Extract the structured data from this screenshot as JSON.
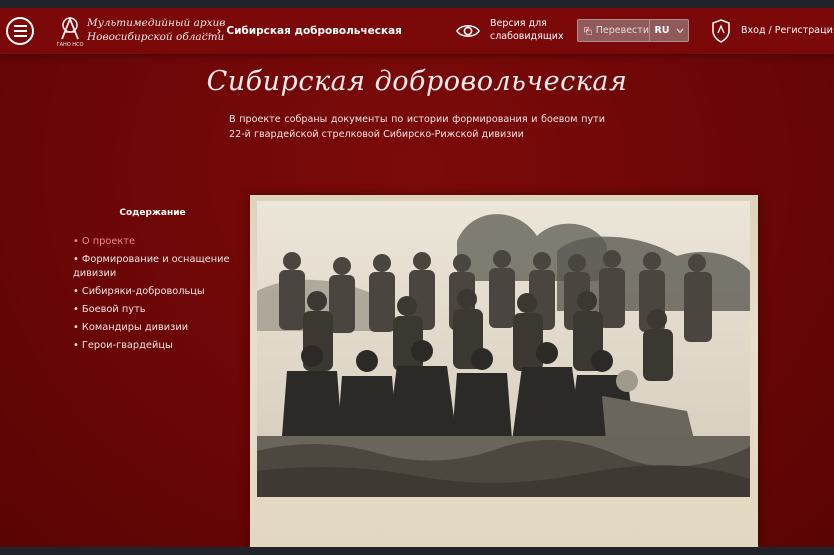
{
  "header": {
    "logo_line1": "Мультимедийный архив",
    "logo_line2": "Новосибирской области",
    "logo_caption": "ГАНО НСО",
    "breadcrumb_dots": "...",
    "breadcrumb_current": "Сибирская добровольческая",
    "low_vision_line1": "Версия для",
    "low_vision_line2": "слабовидящих",
    "translate_label": "Перевести",
    "language": "RU",
    "login_label": "Вход / Регистрация"
  },
  "main": {
    "title": "Сибирская добровольческая",
    "description": "В проекте собраны документы по истории формирования и боевом пути 22-й гвардейской стрелковой Сибирско-Рижской дивизии"
  },
  "toc": {
    "heading": "Содержание",
    "items": [
      {
        "label": "• О проекте",
        "active": true
      },
      {
        "label": "• Формирование и оснащение дивизии",
        "active": false
      },
      {
        "label": "• Сибиряки-добровольцы",
        "active": false
      },
      {
        "label": "• Боевой путь",
        "active": false
      },
      {
        "label": "• Командиры дивизии",
        "active": false
      },
      {
        "label": "• Герои-гвардейцы",
        "active": false
      }
    ]
  },
  "colors": {
    "background": "#6a0606",
    "header": "#7a0808",
    "active_link": "#f08a8a",
    "photo_paper": "#e6dcc7"
  },
  "icons": [
    "menu-icon",
    "archive-logo-icon",
    "chevron-right-icon",
    "eye-icon",
    "translate-icon",
    "chevron-down-icon",
    "shield-icon"
  ]
}
